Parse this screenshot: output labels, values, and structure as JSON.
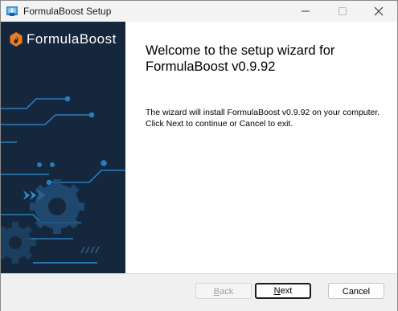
{
  "window": {
    "title": "FormulaBoost Setup",
    "app_icon": "installer-icon",
    "controls": {
      "minimize_icon": "minimize-icon",
      "maximize_icon": "maximize-icon",
      "close_icon": "close-icon"
    }
  },
  "sidebar": {
    "logo_text": "FormulaBoost",
    "logo_icon": "flame-hexagon-icon",
    "artwork": "circuit-gears-artwork"
  },
  "content": {
    "heading": "Welcome to the setup wizard for FormulaBoost v0.9.92",
    "body": "The wizard will install FormulaBoost v0.9.92 on your computer. Click Next to continue or Cancel to exit."
  },
  "footer": {
    "back_first": "B",
    "back_rest": "ack",
    "next_first": "N",
    "next_rest": "ext",
    "cancel_label": "Cancel"
  },
  "colors": {
    "sidebar_bg": "#14273c",
    "accent_orange": "#f07c1e",
    "circuit_blue": "#2a8fd0"
  }
}
